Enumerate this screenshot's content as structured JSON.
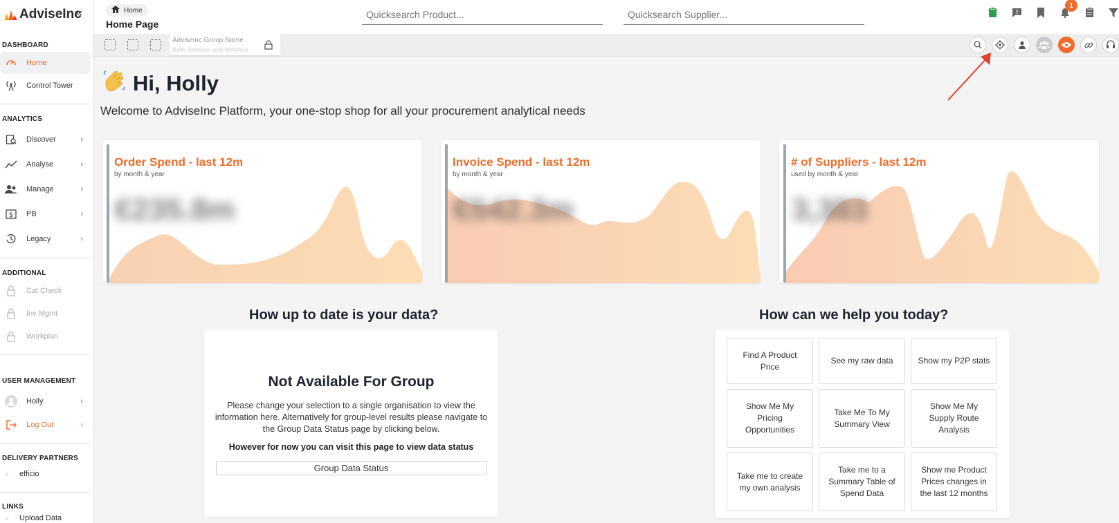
{
  "brand": {
    "name": "AdviseInc",
    "collapse_glyph": "«",
    "accent": "#ef6c2a"
  },
  "sidebar": {
    "dashboard_head": "DASHBOARD",
    "home": "Home",
    "control_tower": "Control Tower",
    "analytics_head": "ANALYTICS",
    "discover": "Discover",
    "analyse": "Analyse",
    "manage": "Manage",
    "pb": "PB",
    "legacy": "Legacy",
    "additional_head": "ADDITIONAL",
    "cat_check": "Cat Check",
    "inv_mgmt": "Inv Mgmt",
    "workplan": "Workplan",
    "user_head": "USER MANAGEMENT",
    "user": "Holly",
    "logout": "Log Out",
    "delivery_head": "DELIVERY PARTNERS",
    "partner": "efficio",
    "links_head": "LINKS",
    "upload": "Upload Data",
    "chevron": "›"
  },
  "header": {
    "breadcrumb": "Home",
    "title": "Home Page",
    "search_product_placeholder": "Quicksearch Product...",
    "search_supplier_placeholder": "Quicksearch Supplier...",
    "notification_count": "1"
  },
  "toolbar": {
    "group_label": "Adviseinc Group Name",
    "group_value": "Bath Swindon and Wiltshire"
  },
  "main": {
    "greeting": "Hi, Holly",
    "welcome": "Welcome to AdviseInc Platform, your one-stop shop for all your procurement analytical needs",
    "cards": [
      {
        "title": "Order Spend - last 12m",
        "subtitle": "by month & year",
        "value": "€235.8m"
      },
      {
        "title": "Invoice Spend - last 12m",
        "subtitle": "by month & year",
        "value": "€542.3m"
      },
      {
        "title": "# of Suppliers - last 12m",
        "subtitle": "used by month & year",
        "value": "3,383"
      }
    ],
    "data_section_title": "How up to date is your data?",
    "na_title": "Not Available For Group",
    "na_body": "Please change your selection to a single organisation to view the information here. Alternatively for group-level results please navigate to the Group Data Status page by clicking below.",
    "na_bold": "However for now you can visit this page to view data status",
    "na_button": "Group Data Status",
    "help_title": "How can we help you today?",
    "help_buttons": [
      "Find A Product Price",
      "See my raw data",
      "Show my P2P stats",
      "Show Me My Pricing Opportunities",
      "Take Me To My Summary View",
      "Show Me My Supply Route Analysis",
      "Take me to create my own analysis",
      "Take me to a Summary Table of Spend Data",
      "Show me Product Prices changes in the last 12 months"
    ]
  }
}
